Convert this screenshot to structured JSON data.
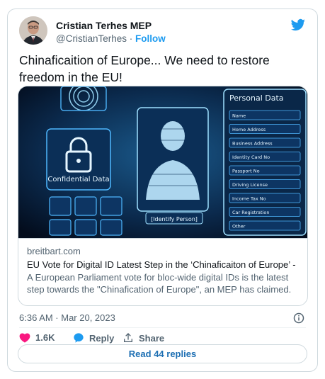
{
  "author": {
    "name": "Cristian Terhes MEP",
    "handle": "@CristianTerhes",
    "separator": "·",
    "follow_label": "Follow"
  },
  "tweet": {
    "text": "Chinaficaition of Europe... We need to restore freedom in the EU!"
  },
  "card": {
    "image_labels": {
      "personal_data": "Personal Data",
      "confidential": "Confidential Data",
      "identify_person": "[Identify Person]",
      "fields": [
        "Name",
        "Home Address",
        "Business Address",
        "Identity Card No",
        "Passport No",
        "Driving License",
        "Income Tax No",
        "Car Registration",
        "Other"
      ]
    },
    "domain": "breitbart.com",
    "title": "EU Vote for Digital ID Latest Step in the ‘Chinaficaiton of Europe’ - MEP",
    "description": "A European Parliament vote for bloc-wide digital IDs is the latest step towards the \"Chinafication of Europe\", an MEP has claimed."
  },
  "meta": {
    "timestamp": "6:36 AM · Mar 20, 2023"
  },
  "actions": {
    "likes": "1.6K",
    "reply_label": "Reply",
    "share_label": "Share"
  },
  "read_replies_label": "Read 44 replies",
  "colors": {
    "brand_blue": "#1d9bf0",
    "like_pink": "#f91880",
    "text_secondary": "#536471",
    "border": "#cfd9de"
  },
  "icons": [
    "twitter-logo-icon",
    "info-icon",
    "heart-icon",
    "reply-bubble-icon",
    "share-icon"
  ]
}
